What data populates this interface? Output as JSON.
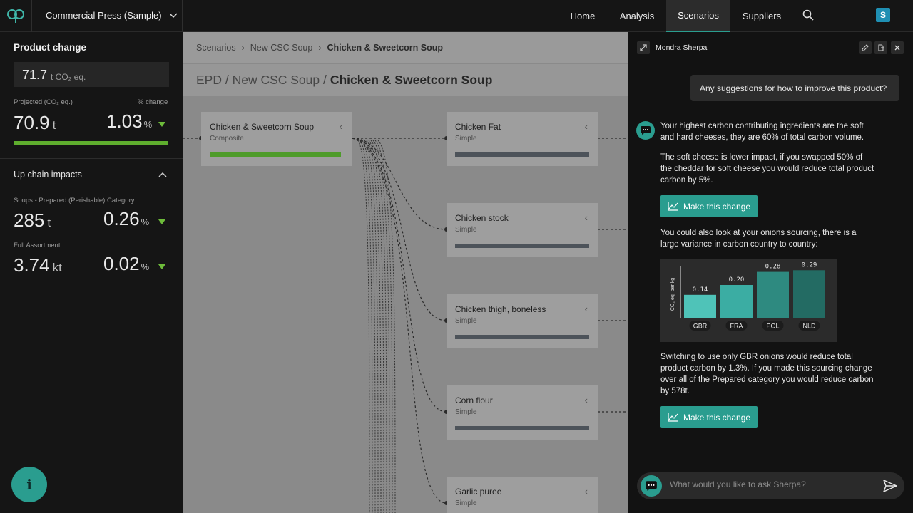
{
  "header": {
    "project": "Commercial Press (Sample)",
    "nav": [
      "Home",
      "Analysis",
      "Scenarios",
      "Suppliers"
    ],
    "active_nav": "Scenarios",
    "avatar": "S",
    "accent": "#2a9d8f"
  },
  "left_panel": {
    "title": "Product change",
    "current_value": "71.7",
    "current_unit": "t CO₂ eq.",
    "projected_label": "Projected (CO₂ eq.)",
    "change_label": "% change",
    "projected_value": "70.9",
    "projected_unit": "t",
    "projected_pct": "1.03",
    "pct_unit": "%",
    "upchain_title": "Up chain impacts",
    "category_label": "Soups - Prepared (Perishable) Category",
    "category_value": "285",
    "category_unit": "t",
    "category_pct": "0.26",
    "assortment_label": "Full Assortment",
    "assortment_value": "3.74",
    "assortment_unit": "kt",
    "assortment_pct": "0.02",
    "info_icon": "i"
  },
  "center": {
    "breadcrumb": [
      "Scenarios",
      "New CSC Soup",
      "Chicken & Sweetcorn Soup"
    ],
    "epd_prefix": "EPD / New CSC Soup /",
    "epd_title": "Chicken & Sweetcorn Soup",
    "root_node": {
      "name": "Chicken & Sweetcorn Soup",
      "type": "Composite"
    },
    "nodes": [
      {
        "name": "Chicken Fat",
        "type": "Simple"
      },
      {
        "name": "Chicken stock",
        "type": "Simple"
      },
      {
        "name": "Chicken thigh, boneless",
        "type": "Simple"
      },
      {
        "name": "Corn flour",
        "type": "Simple"
      },
      {
        "name": "Garlic puree",
        "type": "Simple"
      }
    ]
  },
  "chat": {
    "title": "Mondra Sherpa",
    "user_message": "Any suggestions for how to improve this product?",
    "p1": "Your highest carbon contributing ingredients are the soft and hard cheeses, they are 60% of total carbon volume.",
    "p2": "The soft cheese is lower impact, if you swapped 50% of the cheddar for soft cheese you would reduce total product carbon by 5%.",
    "make_change_1": "Make this change",
    "p3": "You could also look at your onions sourcing, there is a large variance in carbon country to country:",
    "p4": "Switching to use only GBR onions would reduce total product carbon by 1.3%. If you made this sourcing change over all of the Prepared category you would reduce carbon by 578t.",
    "make_change_2": "Make this change",
    "input_placeholder": "What would you like to ask Sherpa?"
  },
  "chart_data": {
    "type": "bar",
    "categories": [
      "GBR",
      "FRA",
      "POL",
      "NLD"
    ],
    "values": [
      0.14,
      0.2,
      0.28,
      0.29
    ],
    "value_labels": [
      "0.14",
      "0.20",
      "0.28",
      "0.29"
    ],
    "ylabel": "CO₂ eq. per kg",
    "colors": [
      "#4fc3b8",
      "#3bada3",
      "#2e8a80",
      "#236b63"
    ]
  }
}
